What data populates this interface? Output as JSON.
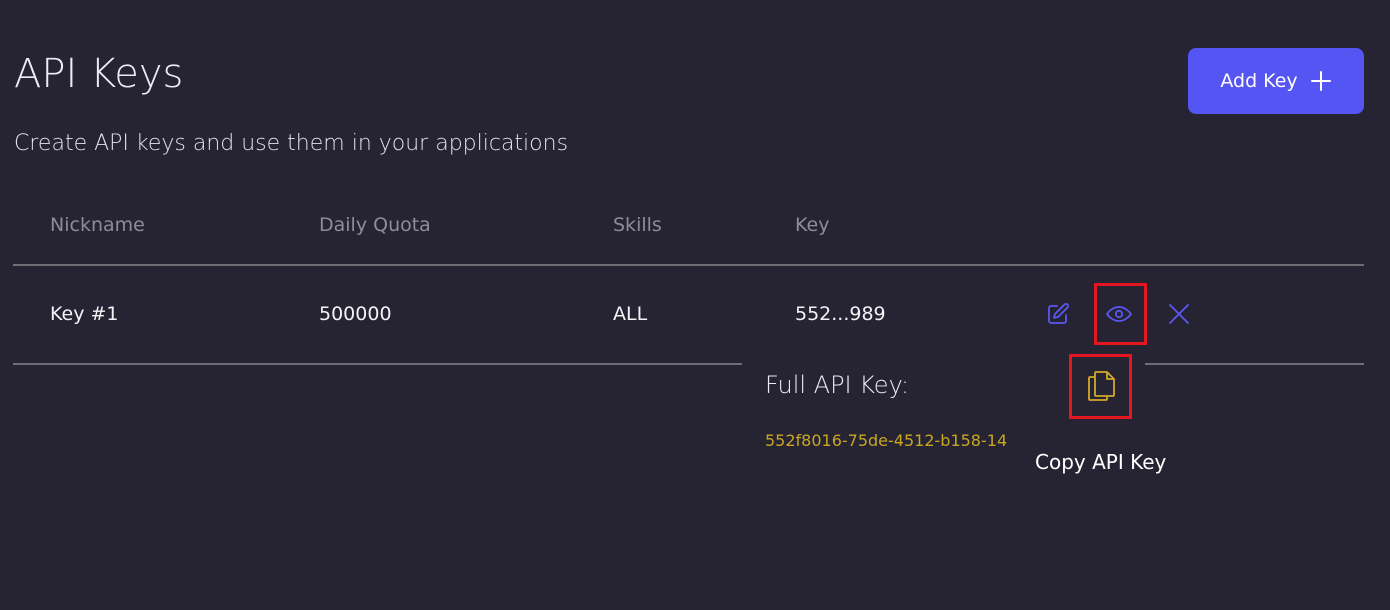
{
  "page": {
    "title": "API Keys",
    "subtitle": "Create API keys and use them in your applications",
    "add_button_label": "Add Key"
  },
  "table": {
    "columns": [
      "Nickname",
      "Daily Quota",
      "Skills",
      "Key"
    ],
    "rows": [
      {
        "nickname": "Key #1",
        "daily_quota": "500000",
        "skills": "ALL",
        "key_masked": "552...989"
      }
    ],
    "row_actions": [
      "edit-icon",
      "eye-icon",
      "close-icon"
    ]
  },
  "key_reveal": {
    "label": "Full API Key:",
    "full_key": "552f8016-75de-4512-b158-14",
    "copy_icon": "copy-icon",
    "copy_tooltip": "Copy API Key"
  },
  "colors": {
    "background": "#262433",
    "accent": "#5455f3",
    "key_text": "#c9a622",
    "highlight": "#e4161f"
  }
}
